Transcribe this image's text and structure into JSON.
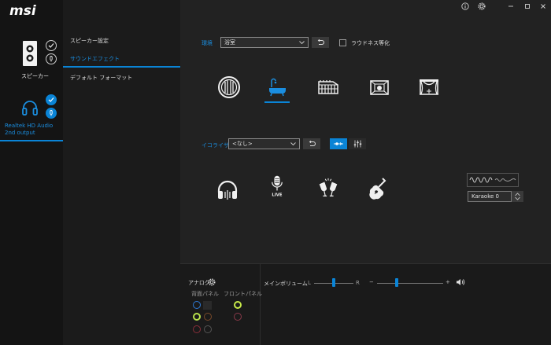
{
  "app": {
    "logo": "msi"
  },
  "titlebar": {
    "icons": [
      "info-icon",
      "gear-icon",
      "minimize-icon",
      "maximize-icon",
      "close-icon"
    ]
  },
  "devices": [
    {
      "label": "スピーカー"
    },
    {
      "label": "Realtek HD Audio 2nd output"
    }
  ],
  "subnav": {
    "items": [
      {
        "label": "スピーカー設定"
      },
      {
        "label": "サウンドエフェクト"
      },
      {
        "label": "デフォルト フォーマット"
      }
    ]
  },
  "environment": {
    "label": "環境",
    "selected": "浴室",
    "loudness_label": "ラウドネス等化",
    "icons": [
      "stone-sphere-icon",
      "bathroom-icon",
      "colosseum-icon",
      "stage-room-icon",
      "opera-theater-icon"
    ]
  },
  "equalizer": {
    "label": "イコライザ",
    "selected": "<なし>",
    "presets": [
      "headphones-icon",
      "live-mic-icon",
      "party-cheers-icon",
      "guitar-icon"
    ],
    "karaoke_value": "Karaoke 0"
  },
  "analog": {
    "title": "アナログ",
    "back_panel_label": "背面パネル",
    "front_panel_label": "フロントパネル",
    "colors": {
      "blue": "#2e7bd8",
      "green": "#b7e04b",
      "brown": "#7a4a2a",
      "red": "#8a2e3a",
      "yellow_green": "#c8ea4a",
      "pink": "#8a3a4a"
    }
  },
  "volume": {
    "label": "メインボリューム",
    "balance_left": "L",
    "balance_right": "R",
    "minus": "−",
    "plus": "+",
    "balance_value": 0.5,
    "level_value": 0.3
  },
  "accent": "#0a84d6"
}
